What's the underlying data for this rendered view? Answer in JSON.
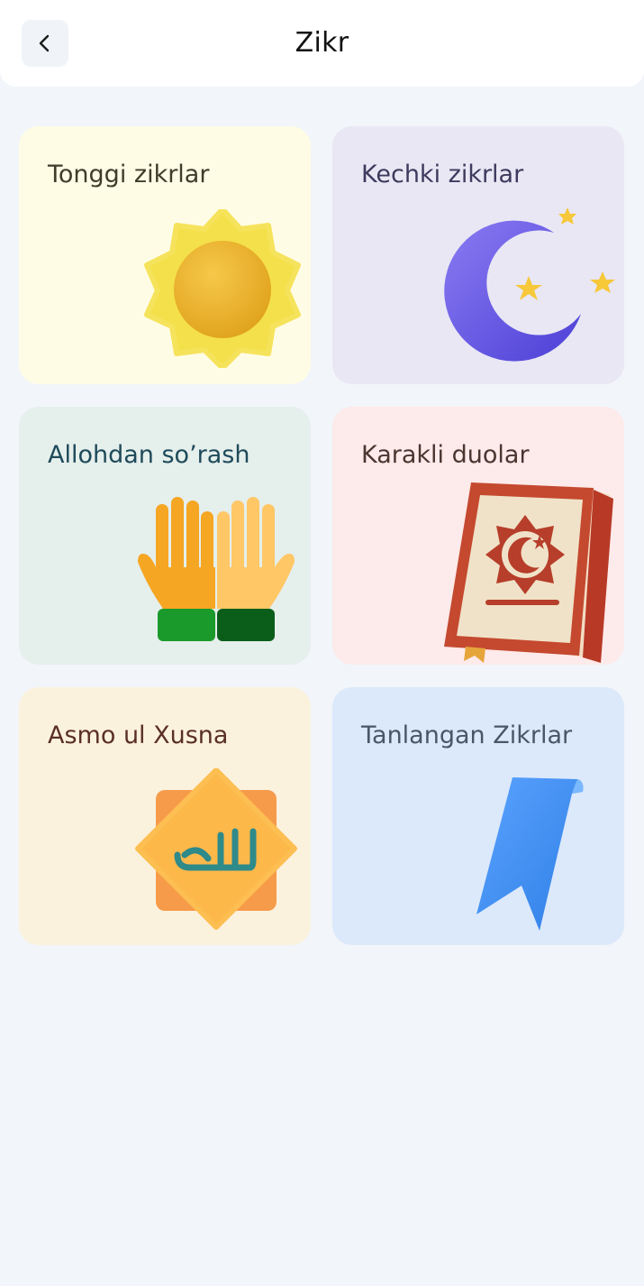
{
  "header": {
    "title": "Zikr",
    "back_icon": "chevron-left-icon"
  },
  "cards": [
    {
      "label": "Tonggi zikrlar",
      "icon": "sun-icon",
      "bg": "#fffce6",
      "text": "#3d3d2a"
    },
    {
      "label": "Kechki zikrlar",
      "icon": "crescent-moon-icon",
      "bg": "#e9e7f4",
      "text": "#3d3a5e"
    },
    {
      "label": "Allohdan so’rash",
      "icon": "praying-hands-icon",
      "bg": "#e5efec",
      "text": "#1e4a5a"
    },
    {
      "label": "Karakli duolar",
      "icon": "quran-book-icon",
      "bg": "#fdeaea",
      "text": "#4a3530"
    },
    {
      "label": "Asmo ul Xusna",
      "icon": "allah-badge-icon",
      "bg": "#fbf2de",
      "text": "#5a3025"
    },
    {
      "label": "Tanlangan Zikrlar",
      "icon": "bookmark-icon",
      "bg": "#dce9fb",
      "text": "#4a5666"
    }
  ]
}
